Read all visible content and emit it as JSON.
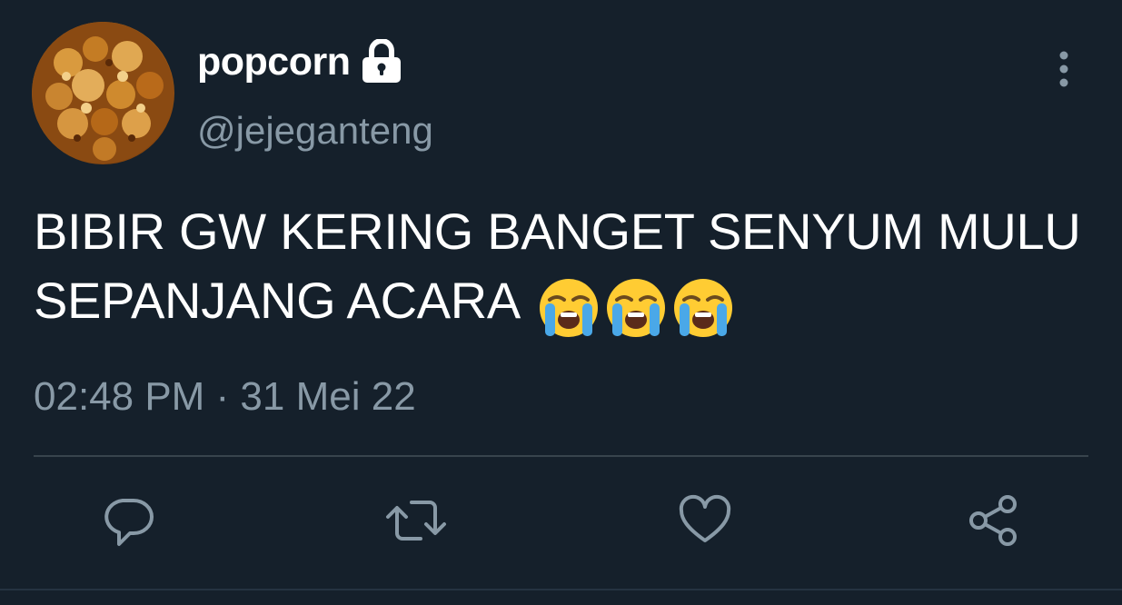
{
  "user": {
    "display_name": "popcorn",
    "handle": "@jejeganteng",
    "protected_icon": "lock-icon",
    "avatar_icon": "popcorn-avatar"
  },
  "tweet": {
    "text": "BIBIR GW KERING BANGET SENYUM MULU SEPANJANG ACARA",
    "emojis": [
      "loudly-crying-face",
      "loudly-crying-face",
      "loudly-crying-face"
    ],
    "timestamp": "02:48 PM · 31 Mei 22"
  },
  "actions": [
    {
      "name": "reply",
      "icon": "comment-icon"
    },
    {
      "name": "retweet",
      "icon": "retweet-icon"
    },
    {
      "name": "like",
      "icon": "heart-icon"
    },
    {
      "name": "share",
      "icon": "share-icon"
    }
  ],
  "menu_icon": "more-vertical-icon",
  "colors": {
    "background": "#15202b",
    "primary_text": "#ffffff",
    "secondary_text": "#8899a6",
    "divider": "#38444d"
  }
}
